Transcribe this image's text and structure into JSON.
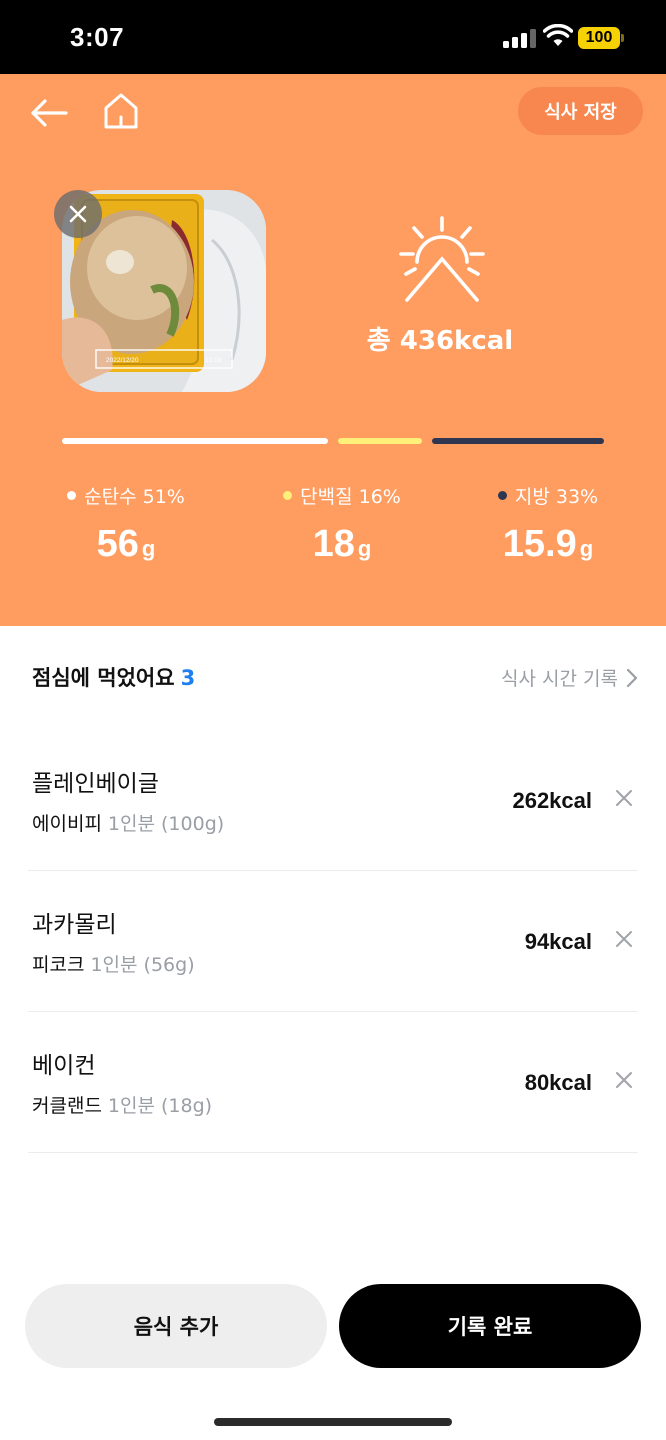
{
  "status_bar": {
    "time": "3:07",
    "battery": "100",
    "battery_color": "#f6d104"
  },
  "header": {
    "back_icon": "arrow-left-icon",
    "home_icon": "home-icon",
    "save_label": "식사 저장"
  },
  "summary": {
    "photo_date": "2022/12/20",
    "photo_time": "12:18",
    "icon": "sun-icon",
    "total_kcal": "총 436kcal",
    "colors": {
      "background": "#ff9c60",
      "carbs": "#ffffff",
      "protein": "#fff07a",
      "fat": "#2f3650"
    }
  },
  "macros": [
    {
      "label": "순탄수 51%",
      "value": "56",
      "unit": "g",
      "percent": 51
    },
    {
      "label": "단백질 16%",
      "value": "18",
      "unit": "g",
      "percent": 16
    },
    {
      "label": "지방 33%",
      "value": "15.9",
      "unit": "g",
      "percent": 33
    }
  ],
  "meal": {
    "title": "점심에 먹었어요",
    "count": "3",
    "time_link": "식사 시간 기록",
    "items": [
      {
        "name": "플레인베이글",
        "brand": "에이비피",
        "amount": "1인분 (100g)",
        "kcal": "262kcal"
      },
      {
        "name": "과카몰리",
        "brand": "피코크",
        "amount": "1인분 (56g)",
        "kcal": "94kcal"
      },
      {
        "name": "베이컨",
        "brand": "커클랜드",
        "amount": "1인분 (18g)",
        "kcal": "80kcal"
      }
    ]
  },
  "footer": {
    "add_label": "음식 추가",
    "done_label": "기록 완료"
  }
}
